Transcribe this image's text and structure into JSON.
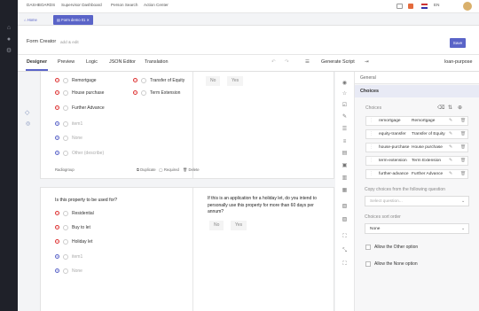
{
  "topbar": {
    "nav": [
      "DASHBOARDS",
      "Supervisor Dashboard",
      "Person Search",
      "Action Center"
    ],
    "lang": "EN"
  },
  "tabs": [
    "Home",
    "Form demo 01"
  ],
  "title": {
    "label": "Form Creator",
    "hint": "add & edit",
    "save_label": "Save"
  },
  "toolbar": {
    "tabs": [
      "Designer",
      "Preview",
      "Logic",
      "JSON Editor",
      "Translation"
    ],
    "generate_script": "Generate Script",
    "form_name": "loan-purpose"
  },
  "card1": {
    "options_left": [
      "Remortgage",
      "House purchase",
      "Further Advance"
    ],
    "options_right": [
      "Transfer of Equity",
      "Term Extension"
    ],
    "placeholders": [
      "item1",
      "None",
      "Other (describe)"
    ],
    "question_type": "Radiogroup",
    "footer": [
      "Duplicate",
      "Required",
      "Delete"
    ],
    "yes_no": [
      "No",
      "Yes"
    ]
  },
  "card2": {
    "question": "Is this property to be used for?",
    "options": [
      "Residential",
      "Buy to let",
      "Holiday let"
    ],
    "placeholders": [
      "item1",
      "None"
    ],
    "question_right": "If this is an application for a holiday let, do you intend to personally use this property for more than 60 days per annum?",
    "yes_no": [
      "No",
      "Yes"
    ]
  },
  "panel": {
    "general": "General",
    "choices": "Choices",
    "choices_label": "Choices",
    "rows": [
      {
        "value": "remortgage",
        "text": "Remortgage"
      },
      {
        "value": "equity-transfer",
        "text": "Transfer of Equity"
      },
      {
        "value": "house-purchase",
        "text": "House purchase"
      },
      {
        "value": "term-extension",
        "text": "Term Extension"
      },
      {
        "value": "further-advance",
        "text": "Further Advance"
      }
    ],
    "copy_label": "Copy choices from the following question",
    "copy_placeholder": "Select question...",
    "sort_label": "Choices sort order",
    "sort_value": "None",
    "allow_other": "Allow the Other option",
    "allow_none": "Allow the None option"
  }
}
